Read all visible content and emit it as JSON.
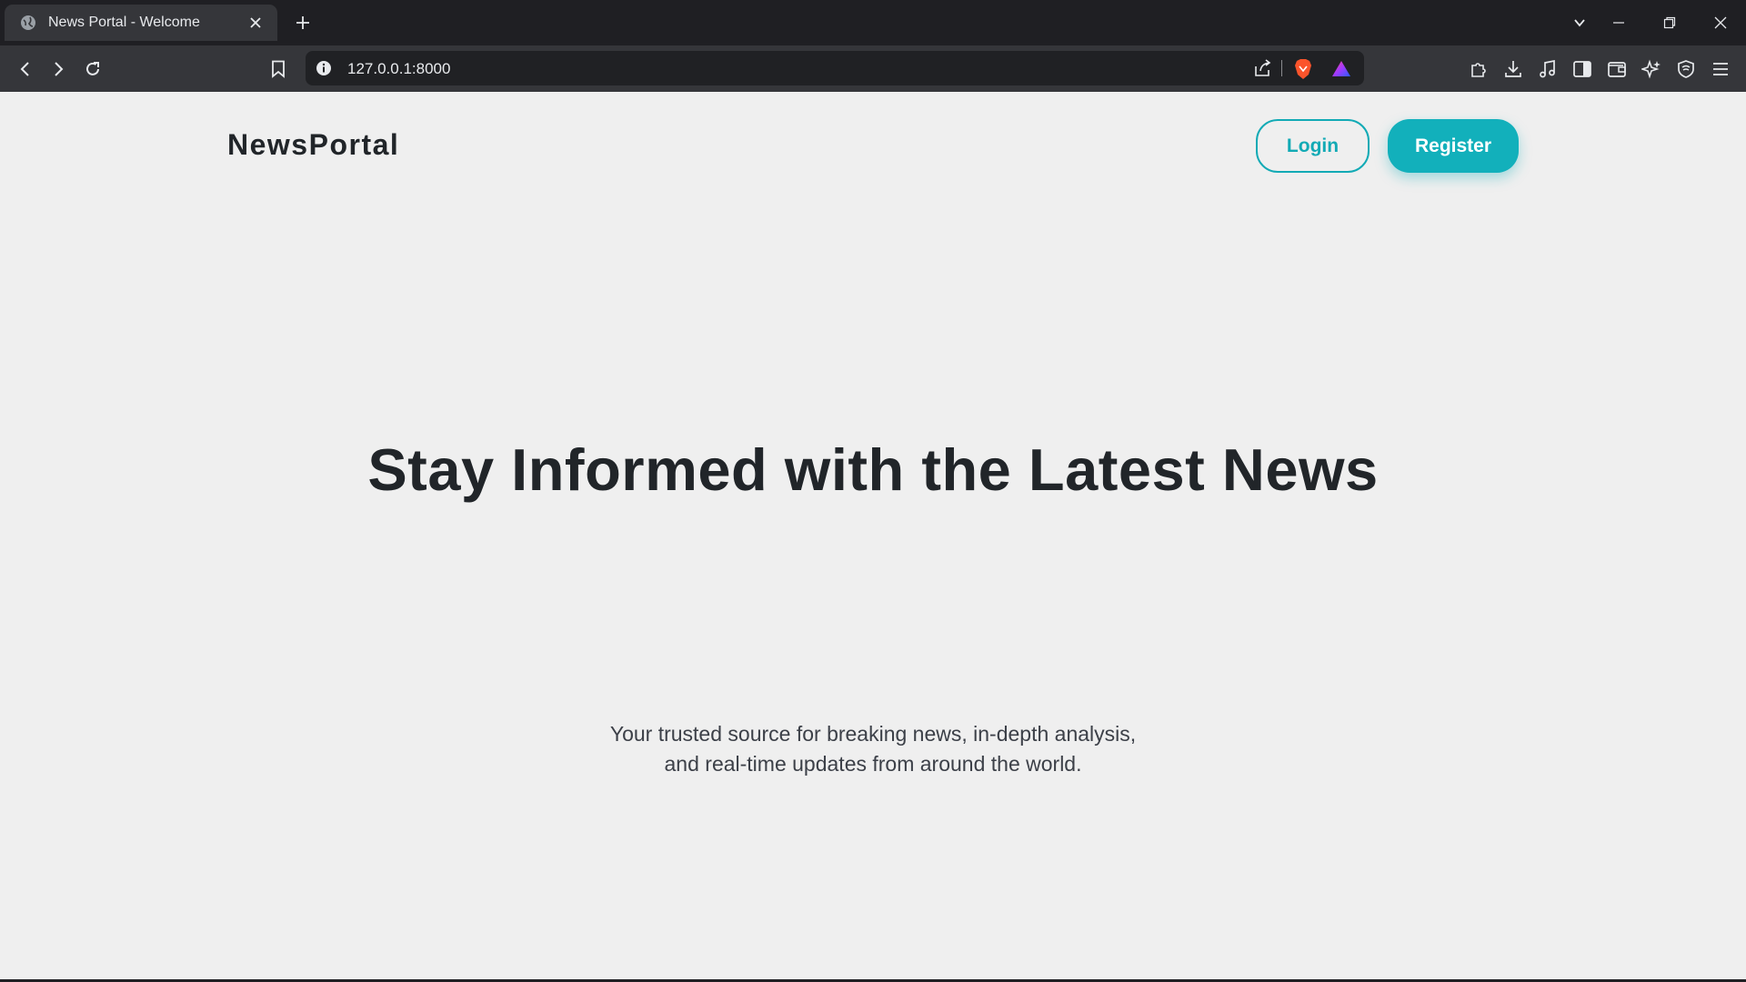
{
  "browser": {
    "tab_title": "News Portal - Welcome",
    "url": "127.0.0.1:8000",
    "icons": {
      "favicon": "globe-icon",
      "close": "close-icon",
      "new_tab": "plus-icon",
      "tab_search": "chevron-down-icon",
      "back": "back-arrow-icon",
      "forward": "forward-arrow-icon",
      "reload": "reload-icon",
      "bookmark": "bookmark-icon",
      "site_info": "info-icon",
      "share": "share-icon",
      "brave_shields": "brave-lion-icon",
      "rewards": "rewards-triangle-icon",
      "extensions": [
        "puzzle-icon",
        "download-icon",
        "music-icon",
        "sidebar-icon",
        "wallet-icon",
        "leo-ai-icon",
        "vpn-shield-icon",
        "menu-icon"
      ]
    }
  },
  "page": {
    "brand": "NewsPortal",
    "nav": {
      "login_label": "Login",
      "register_label": "Register"
    },
    "hero": {
      "title": "Stay Informed with the Latest News",
      "subtitle_line1": "Your trusted source for breaking news, in-depth analysis,",
      "subtitle_line2": "and real-time updates from around the world."
    },
    "colors": {
      "accent": "#12b0bb",
      "text": "#212529",
      "background": "#efefef"
    }
  }
}
